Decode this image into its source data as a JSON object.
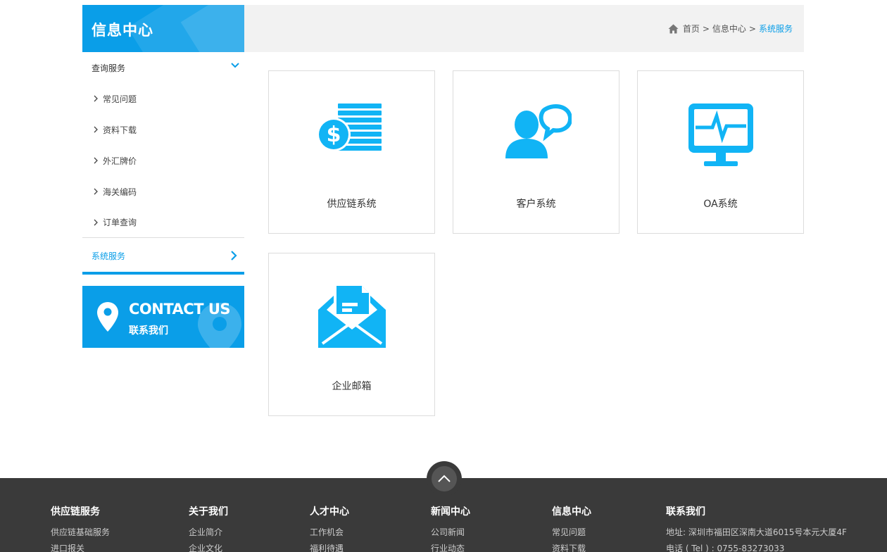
{
  "sidebar": {
    "title": "信息中心",
    "group_label": "查询服务",
    "items": [
      {
        "label": "常见问题"
      },
      {
        "label": "资料下载"
      },
      {
        "label": "外汇牌价"
      },
      {
        "label": "海关编码"
      },
      {
        "label": "订单查询"
      }
    ],
    "active_label": "系统服务",
    "contact_en": "CONTACT US",
    "contact_cn": "联系我们"
  },
  "breadcrumb": {
    "home": "首页",
    "sep": ">",
    "section": "信息中心",
    "current": "系统服务"
  },
  "cards": [
    {
      "label": "供应链系统",
      "icon": "coins-icon"
    },
    {
      "label": "客户系统",
      "icon": "user-chat-icon"
    },
    {
      "label": "OA系统",
      "icon": "monitor-icon"
    },
    {
      "label": "企业邮箱",
      "icon": "mail-icon"
    }
  ],
  "footer": {
    "columns": [
      {
        "heading": "供应链服务",
        "links": [
          "供应链基础服务",
          "进口报关"
        ]
      },
      {
        "heading": "关于我们",
        "links": [
          "企业简介",
          "企业文化"
        ]
      },
      {
        "heading": "人才中心",
        "links": [
          "工作机会",
          "福利待遇"
        ]
      },
      {
        "heading": "新闻中心",
        "links": [
          "公司新闻",
          "行业动态"
        ]
      },
      {
        "heading": "信息中心",
        "links": [
          "常见问题",
          "资料下载"
        ]
      }
    ],
    "contact_heading": "联系我们",
    "address": "地址: 深圳市福田区深南大道6015号本元大厦4F",
    "phone": "电话 ( Tel ) : 0755-83273033"
  },
  "colors": {
    "accent": "#0a9ee8",
    "icon": "#11b4f5",
    "footer_bg": "#3a3a3a"
  }
}
